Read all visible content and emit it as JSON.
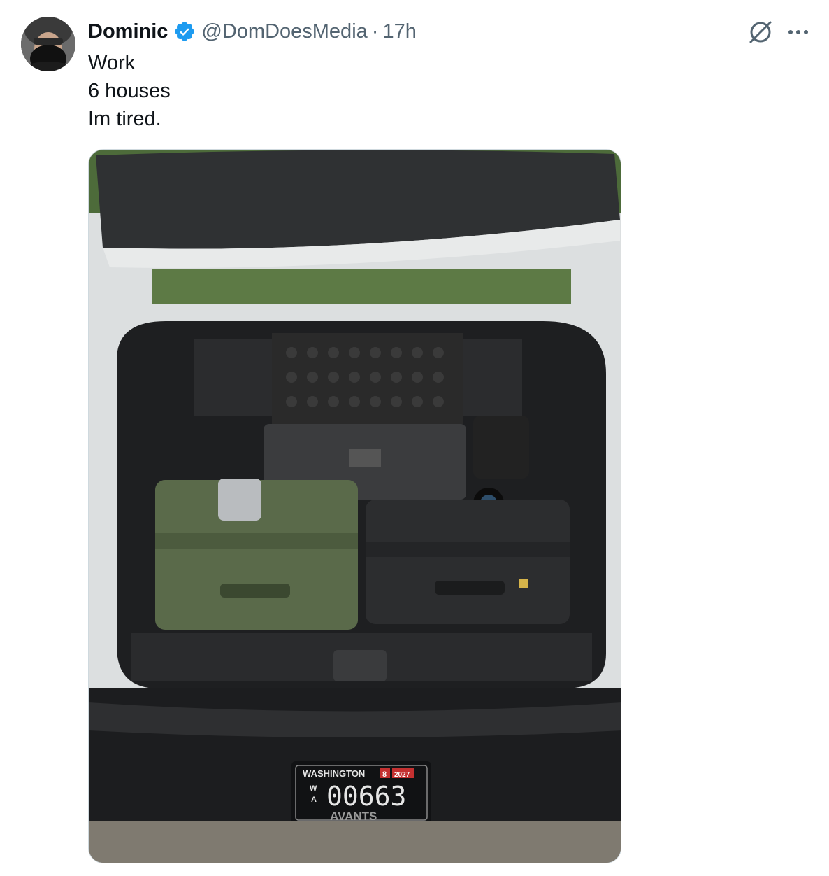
{
  "tweet": {
    "author": {
      "display_name": "Dominic",
      "handle": "@DomDoesMedia",
      "verified": true,
      "avatar_icon": "avatar-photo"
    },
    "separator": "·",
    "timestamp": "17h",
    "text_lines": [
      "Work",
      "6 houses",
      "Im tired."
    ],
    "actions": {
      "grok_icon": "grok-icon",
      "more_icon": "more-icon"
    },
    "media": {
      "type": "photo",
      "plate": {
        "state": "WASHINGTON",
        "month": "8",
        "year": "2027",
        "prefix_top": "W",
        "prefix_bottom": "A",
        "number": "00663",
        "frame": "AVANTS"
      }
    }
  },
  "colors": {
    "verified_blue": "#1d9bf0",
    "text_primary": "#0f1419",
    "text_secondary": "#536471"
  }
}
